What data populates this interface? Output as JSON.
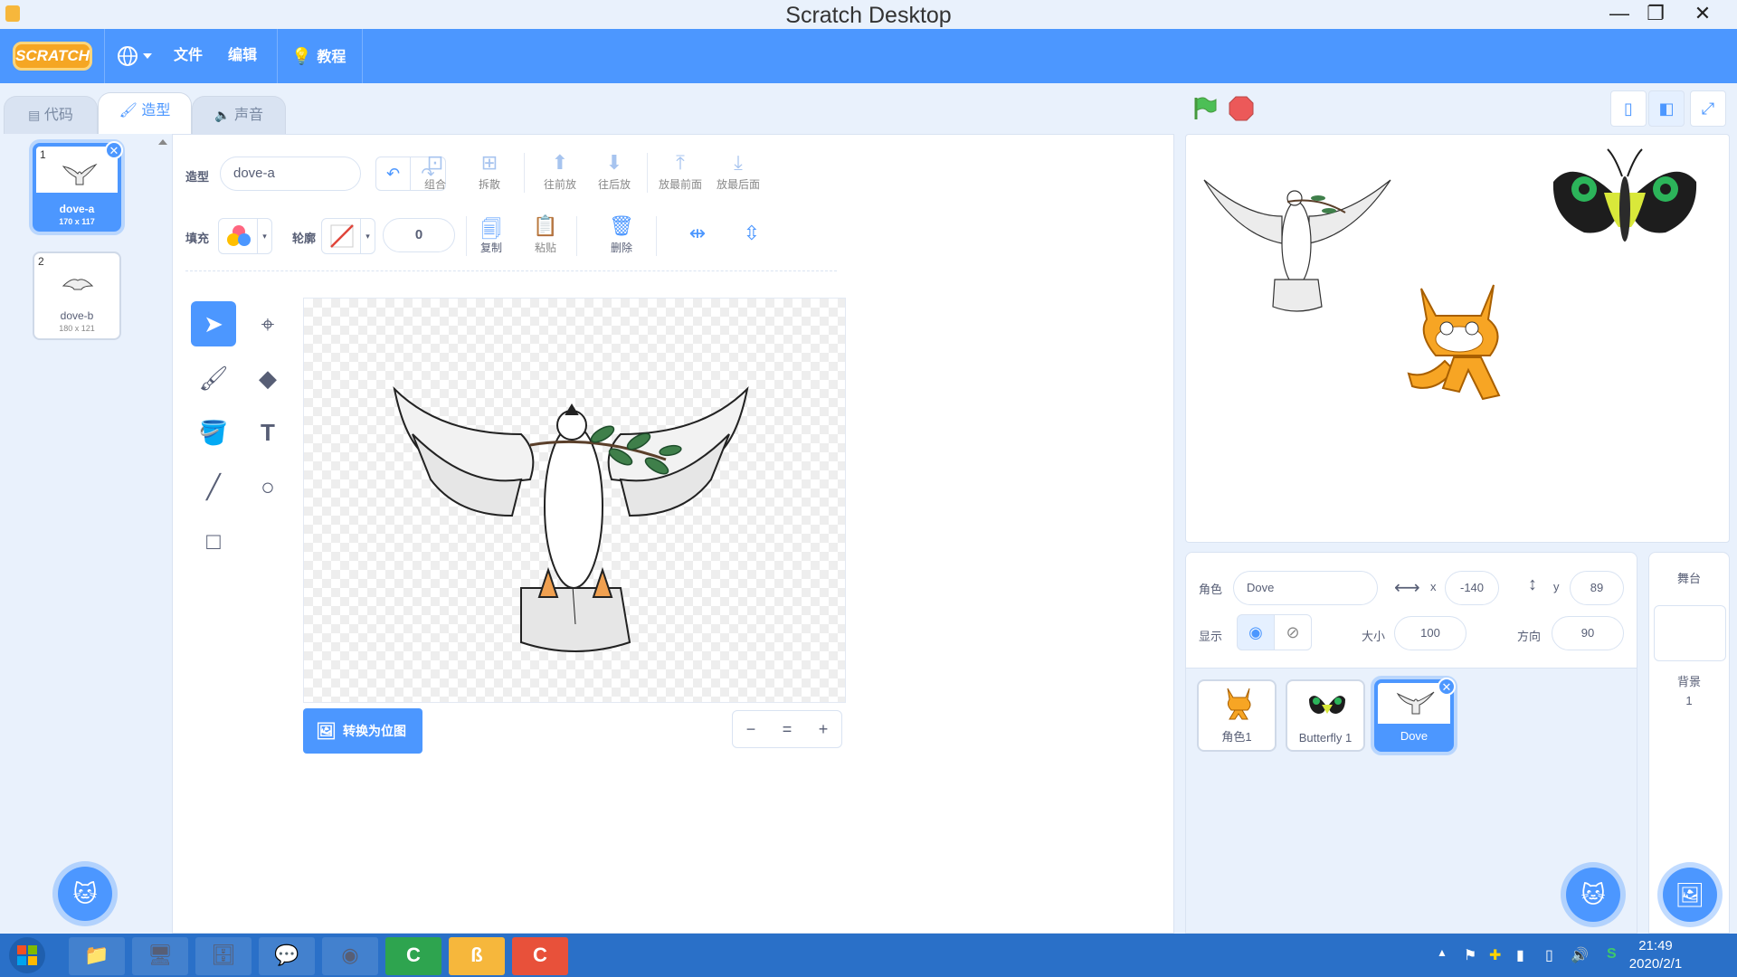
{
  "window": {
    "title": "Scratch Desktop",
    "minimize": "—",
    "restore": "❐",
    "close": "✕"
  },
  "menubar": {
    "logo": "SCRATCH",
    "language_icon": "globe-icon",
    "file": "文件",
    "edit": "编辑",
    "tutorials": "教程"
  },
  "tabs": {
    "code": "代码",
    "costumes": "造型",
    "sounds": "声音"
  },
  "costumes": [
    {
      "number": "1",
      "name": "dove-a",
      "size": "170 x 117",
      "selected": true
    },
    {
      "number": "2",
      "name": "dove-b",
      "size": "180 x 121",
      "selected": false
    }
  ],
  "editor": {
    "costume_label": "造型",
    "costume_name": "dove-a",
    "group": "组合",
    "ungroup": "拆散",
    "forward": "往前放",
    "backward": "往后放",
    "front": "放最前面",
    "back": "放最后面",
    "fill_label": "填充",
    "outline_label": "轮廓",
    "outline_width": "0",
    "copy": "复制",
    "paste": "粘贴",
    "delete": "删除",
    "convert_bitmap": "转换为位图",
    "zoom_out": "−",
    "zoom_reset": "=",
    "zoom_in": "+"
  },
  "sprite_info": {
    "sprite_label": "角色",
    "sprite_name": "Dove",
    "x_label": "x",
    "x_value": "-140",
    "y_label": "y",
    "y_value": "89",
    "show_label": "显示",
    "size_label": "大小",
    "size_value": "100",
    "direction_label": "方向",
    "direction_value": "90"
  },
  "sprites": [
    {
      "name": "角色1"
    },
    {
      "name": "Butterfly 1"
    },
    {
      "name": "Dove"
    }
  ],
  "stage_pane": {
    "title": "舞台",
    "backdrop_label": "背景",
    "backdrop_count": "1"
  },
  "taskbar": {
    "time": "21:49",
    "date": "2020/2/1"
  },
  "colors": {
    "accent": "#4c97ff",
    "menubar": "#4c97ff",
    "taskbar": "#2a70c8"
  }
}
